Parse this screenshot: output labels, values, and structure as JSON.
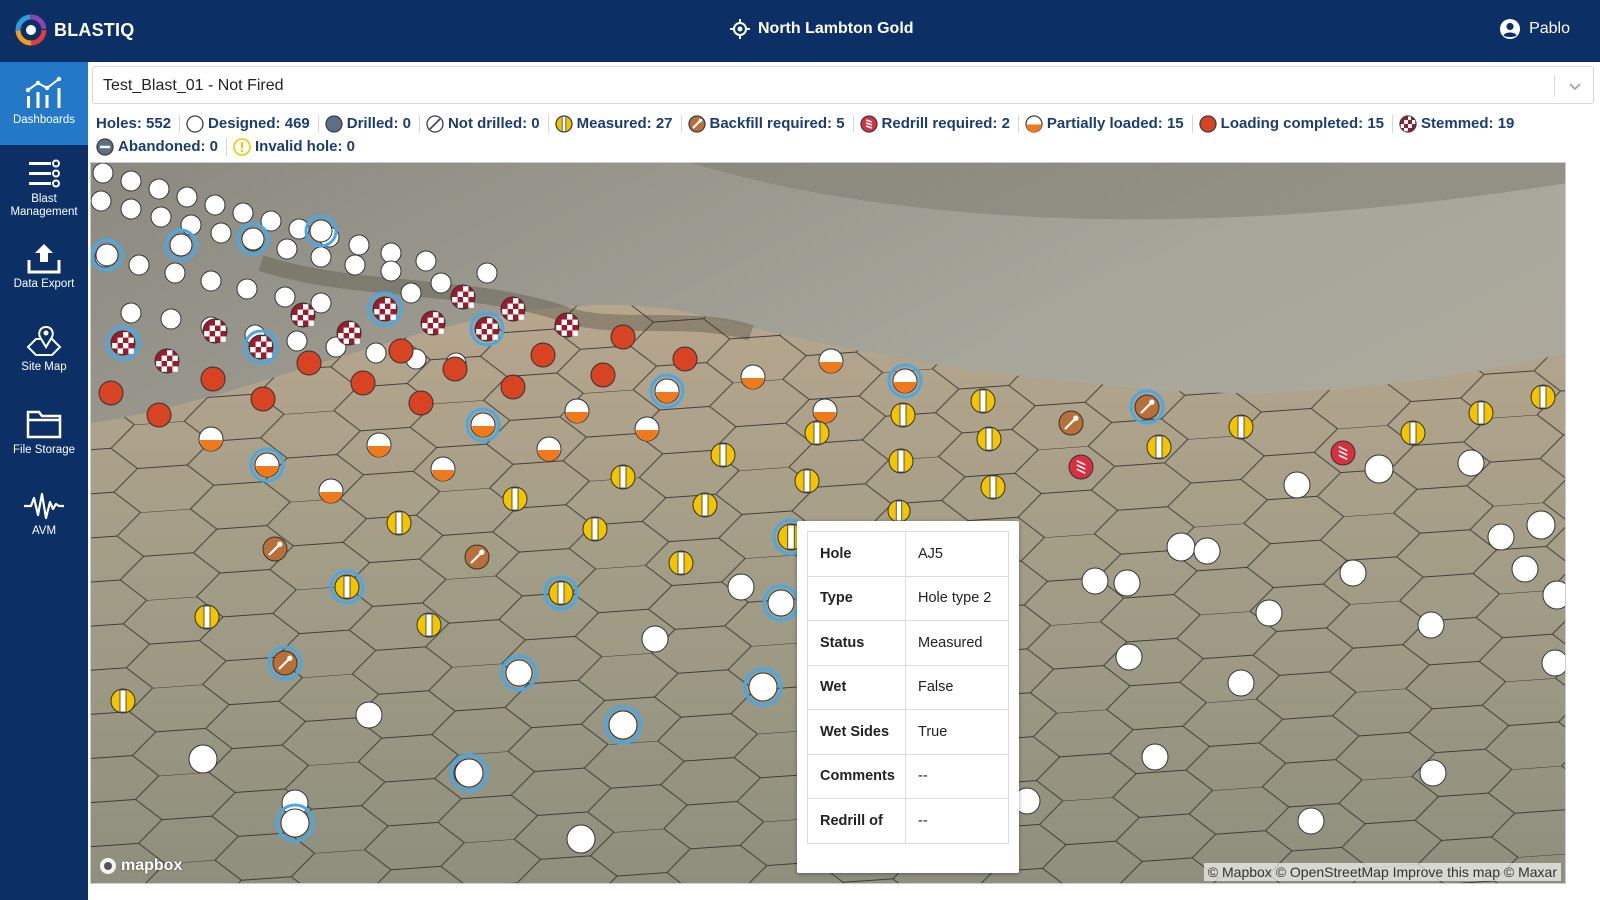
{
  "header": {
    "brand": "BLASTIQ",
    "site": "North Lambton Gold",
    "user": "Pablo"
  },
  "sidebar": {
    "items": [
      {
        "label": "Dashboards",
        "icon": "dashboards-icon",
        "active": true
      },
      {
        "label": "Blast Management",
        "icon": "list-icon",
        "active": false
      },
      {
        "label": "Data Export",
        "icon": "upload-icon",
        "active": false
      },
      {
        "label": "Site Map",
        "icon": "map-pin-icon",
        "active": false
      },
      {
        "label": "File Storage",
        "icon": "folder-icon",
        "active": false
      },
      {
        "label": "AVM",
        "icon": "waveform-icon",
        "active": false
      }
    ]
  },
  "blast_selector": {
    "value": "Test_Blast_01 - Not Fired"
  },
  "legend": {
    "holes": "Holes: 552",
    "designed": "Designed: 469",
    "drilled": "Drilled: 0",
    "not_drilled": "Not drilled: 0",
    "measured": "Measured: 27",
    "backfill": "Backfill required: 5",
    "redrill": "Redrill required: 2",
    "partial": "Partially loaded: 15",
    "loaded": "Loading completed: 15",
    "stemmed": "Stemmed: 19",
    "abandoned": "Abandoned: 0",
    "invalid": "Invalid hole: 0"
  },
  "tooltip": {
    "rows": [
      {
        "key": "Hole",
        "value": "AJ5"
      },
      {
        "key": "Type",
        "value": "Hole type 2"
      },
      {
        "key": "Status",
        "value": "Measured"
      },
      {
        "key": "Wet",
        "value": "False"
      },
      {
        "key": "Wet Sides",
        "value": "True"
      },
      {
        "key": "Comments",
        "value": "--"
      },
      {
        "key": "Redrill of",
        "value": "--"
      }
    ]
  },
  "map": {
    "logo": "mapbox",
    "attribution": "© Mapbox © OpenStreetMap Improve this map © Maxar"
  },
  "colors": {
    "nav": "#0c2f66",
    "nav_active": "#2478c8",
    "loaded": "#d84323",
    "stemmed": "#9b1b2c",
    "measured": "#f2c500",
    "backfill": "#b8703a",
    "redrill": "#d93040",
    "partial": "#ef7a1e"
  }
}
